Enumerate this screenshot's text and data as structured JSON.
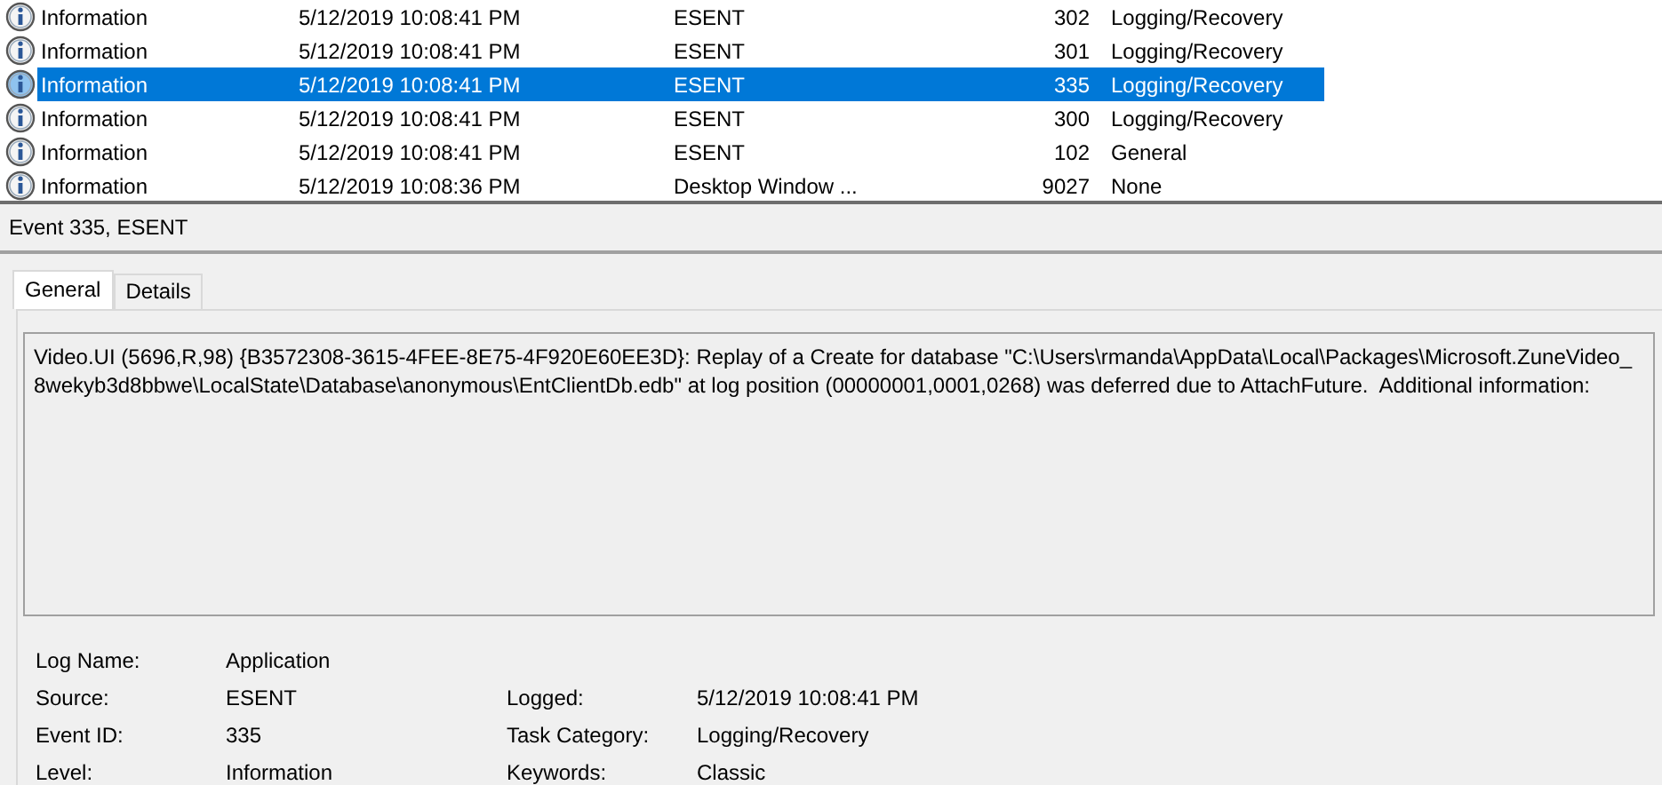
{
  "events": [
    {
      "level": "Information",
      "date": "5/12/2019 10:08:41 PM",
      "source": "ESENT",
      "event_id": "302",
      "category": "Logging/Recovery",
      "selected": false
    },
    {
      "level": "Information",
      "date": "5/12/2019 10:08:41 PM",
      "source": "ESENT",
      "event_id": "301",
      "category": "Logging/Recovery",
      "selected": false
    },
    {
      "level": "Information",
      "date": "5/12/2019 10:08:41 PM",
      "source": "ESENT",
      "event_id": "335",
      "category": "Logging/Recovery",
      "selected": true
    },
    {
      "level": "Information",
      "date": "5/12/2019 10:08:41 PM",
      "source": "ESENT",
      "event_id": "300",
      "category": "Logging/Recovery",
      "selected": false
    },
    {
      "level": "Information",
      "date": "5/12/2019 10:08:41 PM",
      "source": "ESENT",
      "event_id": "102",
      "category": "General",
      "selected": false
    },
    {
      "level": "Information",
      "date": "5/12/2019 10:08:36 PM",
      "source": "Desktop Window ...",
      "event_id": "9027",
      "category": "None",
      "selected": false
    }
  ],
  "detail": {
    "title": "Event 335, ESENT",
    "tabs": [
      {
        "label": "General",
        "selected": true
      },
      {
        "label": "Details",
        "selected": false
      }
    ],
    "message": "Video.UI (5696,R,98) {B3572308-3615-4FEE-8E75-4F920E60EE3D}: Replay of a Create for database \"C:\\Users\\rmanda\\AppData\\Local\\Packages\\Microsoft.ZuneVideo_\n8wekyb3d8bbwe\\LocalState\\Database\\anonymous\\EntClientDb.edb\" at log position (00000001,0001,0268) was deferred due to AttachFuture.  Additional information:",
    "properties": [
      [
        {
          "label": "Log Name:",
          "value": "Application"
        }
      ],
      [
        {
          "label": "Source:",
          "value": "ESENT"
        },
        {
          "label": "Logged:",
          "value": "5/12/2019 10:08:41 PM"
        }
      ],
      [
        {
          "label": "Event ID:",
          "value": "335"
        },
        {
          "label": "Task Category:",
          "value": "Logging/Recovery"
        }
      ],
      [
        {
          "label": "Level:",
          "value": "Information"
        },
        {
          "label": "Keywords:",
          "value": "Classic"
        }
      ]
    ]
  }
}
